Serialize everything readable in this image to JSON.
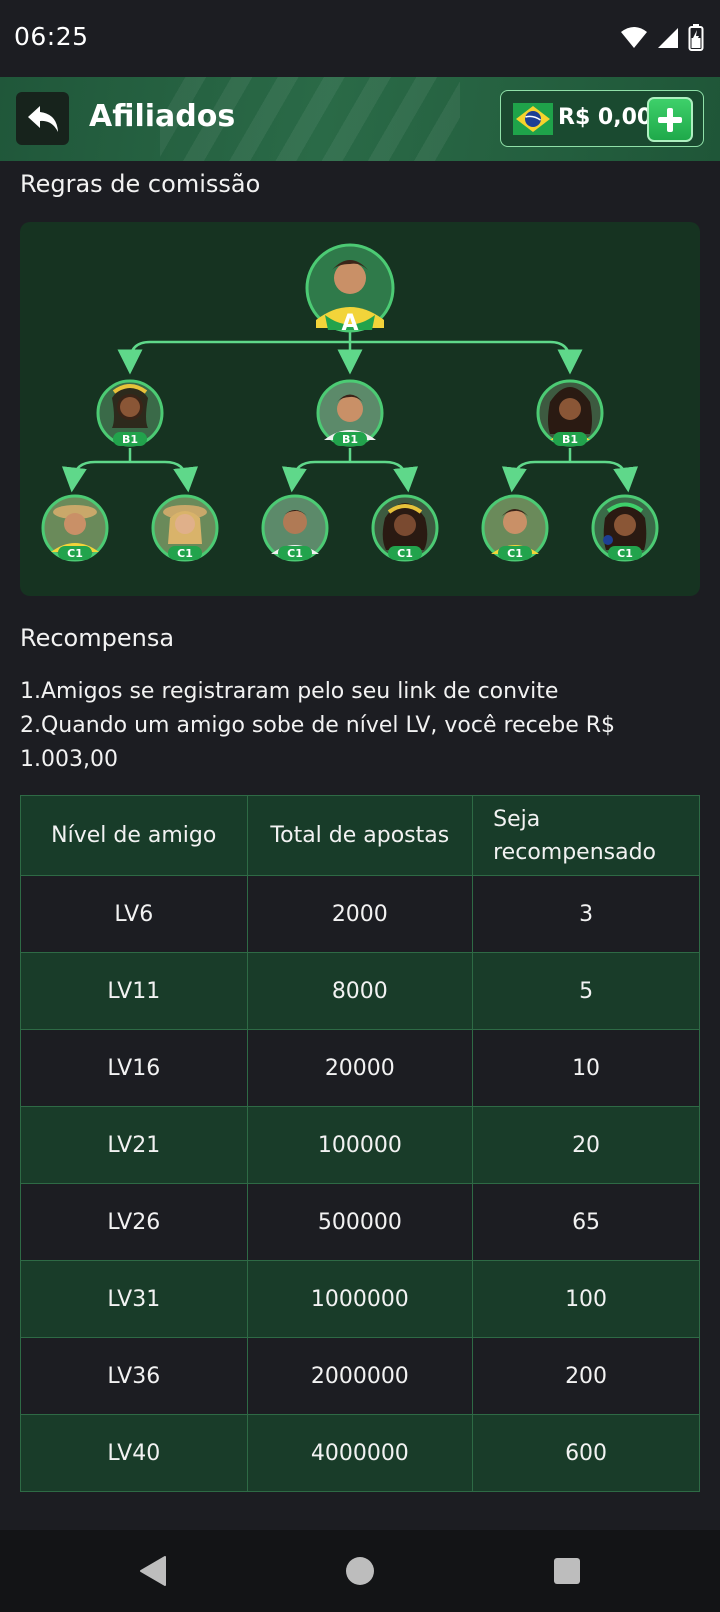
{
  "status_bar": {
    "time": "06:25",
    "icons": [
      "wifi-icon",
      "signal-icon",
      "battery-charging-icon"
    ]
  },
  "header": {
    "back_icon": "reply-arrow-icon",
    "title": "Afiliados",
    "wallet": {
      "flag_icon": "brazil-flag-icon",
      "balance": "R$ 0,00",
      "add_icon": "plus-icon"
    }
  },
  "commission": {
    "title": "Regras de comissão",
    "tree": {
      "root_label": "A",
      "level2_labels": [
        "B1",
        "B1",
        "B1"
      ],
      "level3_labels": [
        "C1",
        "C1",
        "C1",
        "C1",
        "C1",
        "C1"
      ]
    }
  },
  "reward": {
    "title": "Recompensa",
    "rules": [
      "1.Amigos se registraram pelo seu link de convite",
      "2.Quando um amigo sobe de nível LV, você recebe R$",
      "1.003,00"
    ]
  },
  "table": {
    "headers": [
      "Nível de amigo",
      "Total de apostas",
      "Seja",
      "recompensado"
    ],
    "rows": [
      {
        "level": "LV6",
        "bets": "2000",
        "reward": "3"
      },
      {
        "level": "LV11",
        "bets": "8000",
        "reward": "5"
      },
      {
        "level": "LV16",
        "bets": "20000",
        "reward": "10"
      },
      {
        "level": "LV21",
        "bets": "100000",
        "reward": "20"
      },
      {
        "level": "LV26",
        "bets": "500000",
        "reward": "65"
      },
      {
        "level": "LV31",
        "bets": "1000000",
        "reward": "100"
      },
      {
        "level": "LV36",
        "bets": "2000000",
        "reward": "200"
      },
      {
        "level": "LV40",
        "bets": "4000000",
        "reward": "600"
      }
    ]
  },
  "nav": {
    "icons": [
      "back-triangle-icon",
      "home-circle-icon",
      "recents-square-icon"
    ]
  },
  "colors": {
    "background": "#1c1d22",
    "header_green": "#2a6a47",
    "accent_green": "#3ed06a",
    "panel_green": "#163321"
  }
}
